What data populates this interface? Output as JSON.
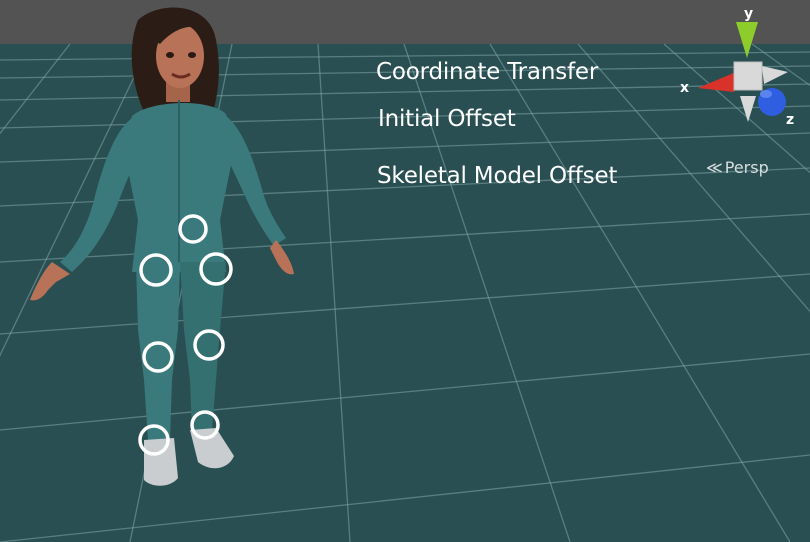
{
  "overlay_labels": {
    "coordinate_transfer": "Coordinate Transfer",
    "initial_offset": "Initial Offset",
    "skeletal_model_offset": "Skeletal Model Offset"
  },
  "view_mode": {
    "label": "Persp",
    "icon": "perspective-chevron-icon"
  },
  "orientation_gizmo": {
    "axis_x": "x",
    "axis_y": "y",
    "axis_z": "z",
    "colors": {
      "x": "#d8322a",
      "y": "#8ccd2c",
      "z": "#2f5fe0",
      "center": "#d9d9d9"
    }
  },
  "colors": {
    "background": "#2a4f52",
    "grid_line": "#7fa6a8",
    "top_strip": "#535353",
    "marker_ring": "#ffffff"
  },
  "joint_markers": [
    "pelvis",
    "left-hip",
    "right-hip",
    "left-knee",
    "right-knee",
    "left-ankle",
    "right-ankle"
  ]
}
